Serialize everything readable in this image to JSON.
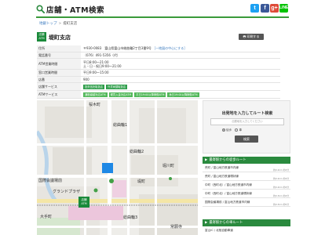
{
  "header": {
    "title": "店舗・ATM検索",
    "social": {
      "twitter": "t",
      "facebook": "f",
      "googleplus": "g+",
      "line": "LINE"
    }
  },
  "breadcrumb": {
    "home": "地銀トップ",
    "current": "堤町支店"
  },
  "store": {
    "badge_line1": "店舗",
    "badge_line2": "ATM",
    "name": "堤町支店",
    "print_label": "印刷する"
  },
  "info": {
    "rows": [
      {
        "label": "住所",
        "value": "〒930-0083　富山県富山市総曲輪2丁目3番9号",
        "link": "［一地図の中心にする］"
      },
      {
        "label": "電話番号",
        "value": "（076）491-5356（代）"
      },
      {
        "label": "ATM営業時間",
        "value1": "平日8:00～21:00",
        "value2": "土・日・祝日9:00～21:00"
      },
      {
        "label": "窓口営業時間",
        "value": "平日9:00～15:00"
      },
      {
        "label": "店番",
        "value": "900"
      }
    ],
    "store_services_label": "店舗サービス",
    "store_services": [
      "投資信託取扱店",
      "外貨両替取扱店"
    ],
    "atm_services_label": "ATMサービス",
    "atm_services": [
      "通帳繰越対応ATM",
      "硬貨入金対応ATM",
      "平日19:00以降稼働ATM",
      "休日19:00以降稼働ATM"
    ]
  },
  "map": {
    "labels": {
      "l1": "桜木町",
      "l2": "総曲輪1",
      "l3": "総曲輪2",
      "l4": "堤町",
      "l5": "大手町",
      "l6": "総曲輪3",
      "l7": "国際会議場前",
      "l8": "グランドプラザ",
      "l9": "常願寺",
      "l10": "堀川町",
      "marker_line1": "店舗",
      "marker_line2": "ATM"
    }
  },
  "route": {
    "title": "出発地を入力してルート検索",
    "placeholder": "出発地を入力してください",
    "opt_walk": "徒歩",
    "opt_car": "車",
    "search_label": "検索"
  },
  "stations": {
    "title": "最寄駅からの徒歩ルート",
    "items": [
      {
        "name": "荒町 / 富山地方鉄道市内線",
        "dist": "約0.2km 約4分"
      },
      {
        "name": "荒町 / 富山地方鉄道環状線",
        "dist": "約0.2km 約4分"
      },
      {
        "name": "中町（西町北）/ 富山地方鉄道市内線",
        "dist": "約0.2km 約4分"
      },
      {
        "name": "中町（西町北）/ 富山地方鉄道環状線",
        "dist": "約0.3km 約4分"
      },
      {
        "name": "国際会議場前 / 富山地方鉄道市内線",
        "dist": "約0.3km 約5分"
      }
    ]
  },
  "bus": {
    "title": "最寄駅からの車ルート",
    "first": "富山IC / 北陸自動車道"
  }
}
